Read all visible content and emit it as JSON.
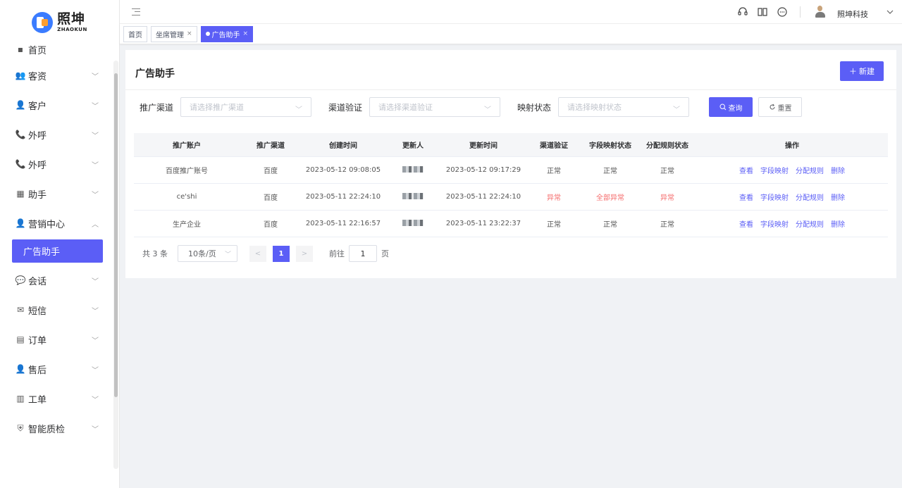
{
  "brand": {
    "name_cn": "照坤",
    "name_en": "ZHAOKUN"
  },
  "sidebar": {
    "partial_top_label": "首页",
    "items": [
      {
        "label": "客资",
        "icon": "users-icon",
        "expanded": false
      },
      {
        "label": "客户",
        "icon": "user-icon",
        "expanded": false
      },
      {
        "label": "外呼",
        "icon": "phone-call-icon",
        "expanded": false
      },
      {
        "label": "外呼",
        "icon": "phone-call-icon",
        "expanded": false
      },
      {
        "label": "助手",
        "icon": "chart-icon",
        "expanded": false
      },
      {
        "label": "营销中心",
        "icon": "user-icon",
        "expanded": true
      },
      {
        "label": "会话",
        "icon": "chat-icon",
        "expanded": false
      },
      {
        "label": "短信",
        "icon": "mail-icon",
        "expanded": false
      },
      {
        "label": "订单",
        "icon": "document-icon",
        "expanded": false
      },
      {
        "label": "售后",
        "icon": "user-headset-icon",
        "expanded": false
      },
      {
        "label": "工单",
        "icon": "clipboard-icon",
        "expanded": false
      },
      {
        "label": "智能质检",
        "icon": "shield-icon",
        "expanded": false
      }
    ],
    "active_submenu": "广告助手"
  },
  "header": {
    "username": "照坤科技"
  },
  "tags": [
    {
      "label": "首页",
      "closable": false,
      "active": false
    },
    {
      "label": "坐席管理",
      "closable": true,
      "active": false
    },
    {
      "label": "广告助手",
      "closable": true,
      "active": true
    }
  ],
  "page": {
    "title": "广告助手",
    "new_button": "新建"
  },
  "filters": {
    "channel": {
      "label": "推广渠道",
      "placeholder": "请选择推广渠道"
    },
    "verify": {
      "label": "渠道验证",
      "placeholder": "请选择渠道验证"
    },
    "mapping": {
      "label": "映射状态",
      "placeholder": "请选择映射状态"
    },
    "search_button": "查询",
    "reset_button": "重置"
  },
  "table": {
    "columns": [
      "推广账户",
      "推广渠道",
      "创建时间",
      "更新人",
      "更新时间",
      "渠道验证",
      "字段映射状态",
      "分配规则状态",
      "操作"
    ],
    "rows": [
      {
        "account": "百度推广账号",
        "channel": "百度",
        "created": "2023-05-12 09:08:05",
        "updated": "2023-05-12 09:17:29",
        "verify": "正常",
        "field_map": "正常",
        "rule": "正常",
        "verify_error": false,
        "field_error": false,
        "rule_error": false
      },
      {
        "account": "ce'shi",
        "channel": "百度",
        "created": "2023-05-11 22:24:10",
        "updated": "2023-05-11 22:24:10",
        "verify": "异常",
        "field_map": "全部异常",
        "rule": "异常",
        "verify_error": true,
        "field_error": true,
        "rule_error": true
      },
      {
        "account": "生产企业",
        "channel": "百度",
        "created": "2023-05-11 22:16:57",
        "updated": "2023-05-11 23:22:37",
        "verify": "正常",
        "field_map": "正常",
        "rule": "正常",
        "verify_error": false,
        "field_error": false,
        "rule_error": false
      }
    ],
    "actions": [
      "查看",
      "字段映射",
      "分配规则",
      "删除"
    ]
  },
  "pagination": {
    "total": "共 3 条",
    "page_size": "10条/页",
    "current_page": "1",
    "goto_label": "前往",
    "goto_value": "1",
    "goto_suffix": "页"
  },
  "colors": {
    "primary": "#5b5ef6",
    "danger": "#f56c6c"
  }
}
